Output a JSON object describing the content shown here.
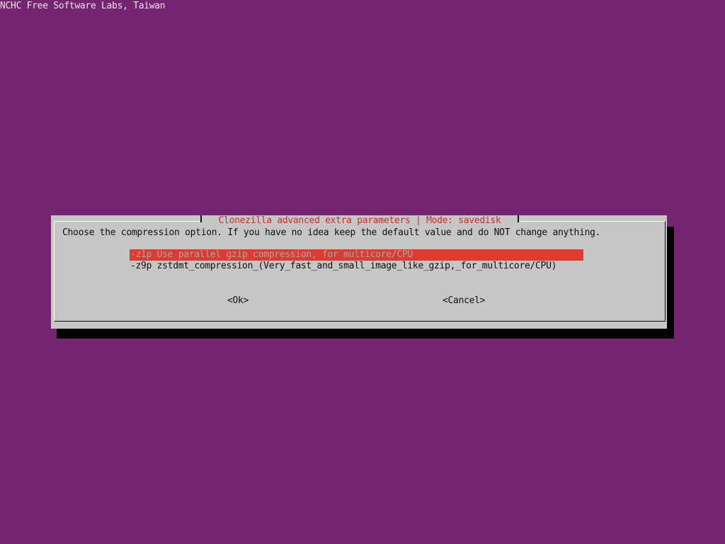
{
  "backtitle": "NCHC Free Software Labs, Taiwan",
  "dialog": {
    "title": "Clonezilla advanced extra parameters | Mode: savedisk",
    "prompt": "Choose the compression option. If you have no idea keep the default value and do NOT change anything.",
    "options": [
      {
        "label": "-z1p Use parallel gzip compression, for multicore/CPU",
        "selected": true
      },
      {
        "label": "-z9p zstdmt_compression_(Very_fast_and_small_image_like_gzip,_for_multicore/CPU)",
        "selected": false
      }
    ],
    "ok_label": "<Ok>",
    "cancel_label": "<Cancel>"
  },
  "colors": {
    "background": "#75246f",
    "dialog": "#c6c6c6",
    "title": "#c8302a",
    "selection": "#dd3a30"
  }
}
